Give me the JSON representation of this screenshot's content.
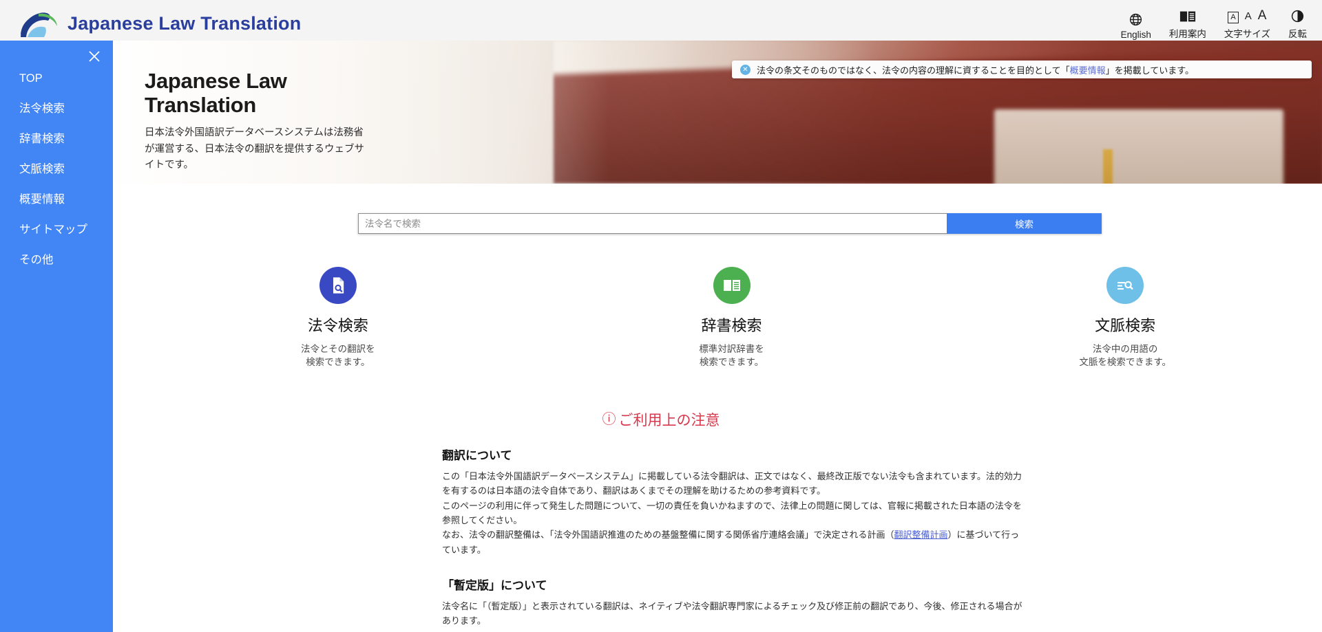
{
  "header": {
    "brand_title": "Japanese Law Translation",
    "logo_icon": "arch-logo-icon",
    "tools": [
      {
        "icon": "globe-icon",
        "label": "English"
      },
      {
        "icon": "open-book-icon",
        "label": "利用案内"
      },
      {
        "icon": "font-size-icon",
        "label": "文字サイズ"
      },
      {
        "icon": "contrast-invert-icon",
        "label": "反転"
      }
    ],
    "font_size_options": [
      "A",
      "A",
      "A"
    ]
  },
  "sidebar": {
    "close_icon": "close-icon",
    "accent_color": "#4285f4",
    "items": [
      {
        "label": "TOP"
      },
      {
        "label": "法令検索"
      },
      {
        "label": "辞書検索"
      },
      {
        "label": "文脈検索"
      },
      {
        "label": "概要情報"
      },
      {
        "label": "サイトマップ"
      },
      {
        "label": "その他"
      }
    ]
  },
  "banner": {
    "close_icon": "close-circle-icon",
    "text_before": "法令の条文そのものではなく、法令の内容の理解に資することを目的として「",
    "link": "概要情報",
    "text_after": "」を掲載しています。",
    "link_color": "#5b6ccf"
  },
  "hero": {
    "title": "Japanese Law Translation",
    "subtitle": "日本法令外国語訳データベースシステムは法務省が運営する、日本法令の翻訳を提供するウェブサイトです。"
  },
  "search": {
    "placeholder": "法令名で検索",
    "value": "",
    "button_label": "検索",
    "button_color": "#3b7ef2"
  },
  "cards": [
    {
      "icon": "document-search-icon",
      "color": "#3949c4",
      "title": "法令検索",
      "desc_line1": "法令とその翻訳を",
      "desc_line2": "検索できます。"
    },
    {
      "icon": "open-book-icon",
      "color": "#4caf50",
      "title": "辞書検索",
      "desc_line1": "標準対訳辞書を",
      "desc_line2": "検索できます。"
    },
    {
      "icon": "list-search-icon",
      "color": "#6fc0e8",
      "title": "文脈検索",
      "desc_line1": "法令中の用語の",
      "desc_line2": "文脈を検索できます。"
    }
  ],
  "notice": {
    "heading_icon": "exclamation-circle-icon",
    "heading": "ご利用上の注意",
    "heading_color": "#d7384c",
    "sections": [
      {
        "title": "翻訳について",
        "p1": "この「日本法令外国語訳データベースシステム」に掲載している法令翻訳は、正文ではなく、最終改正版でない法令も含まれています。法的効力を有するのは日本語の法令自体であり、翻訳はあくまでその理解を助けるための参考資料です。",
        "p2": "このページの利用に伴って発生した問題について、一切の責任を負いかねますので、法律上の問題に関しては、官報に掲載された日本語の法令を参照してください。",
        "p3_before": "なお、法令の翻訳整備は、「法令外国語訳推進のための基盤整備に関する関係省庁連絡会議」で決定される計画（",
        "p3_link": "翻訳整備計画",
        "p3_after": "）に基づいて行っています。"
      },
      {
        "title": "「暫定版」について",
        "p1": "法令名に「（暫定版）」と表示されている翻訳は、ネイティブや法令翻訳専門家によるチェック及び修正前の翻訳であり、今後、修正される場合があります。",
        "p2": "",
        "p3_before": "",
        "p3_link": "",
        "p3_after": ""
      }
    ]
  }
}
